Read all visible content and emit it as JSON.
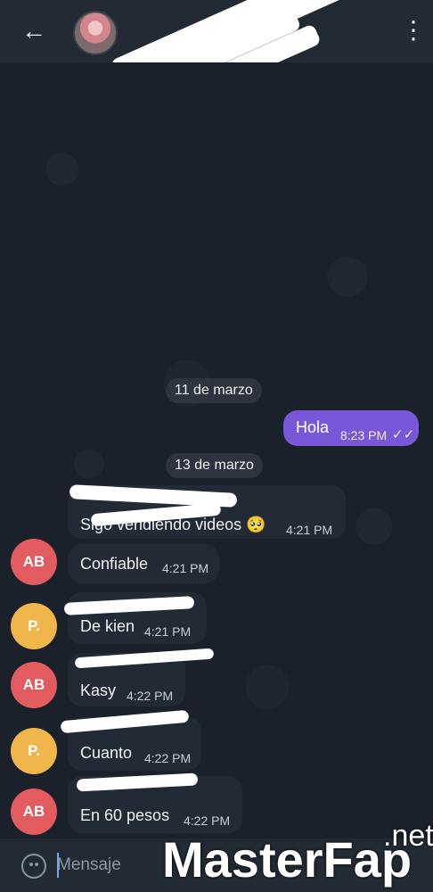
{
  "header": {
    "back_icon": "arrow-left-icon",
    "menu_icon": "more-vertical-icon"
  },
  "chat": {
    "date1": "11 de marzo",
    "outgoing": {
      "text": "Hola",
      "time": "8:23 PM",
      "status_icon": "double-check-icon"
    },
    "date2": "13 de marzo",
    "messages": [
      {
        "avatar": "",
        "text": "Sigo vendiendo videos 🥺",
        "time": "4:21 PM"
      },
      {
        "avatar": "AB",
        "text": "Confiable",
        "time": "4:21 PM"
      },
      {
        "avatar": "P.",
        "text": "De kien",
        "time": "4:21 PM"
      },
      {
        "avatar": "AB",
        "text": "Kasy",
        "time": "4:22 PM"
      },
      {
        "avatar": "P.",
        "text": "Cuanto",
        "time": "4:22 PM"
      },
      {
        "avatar": "AB",
        "text": "En 60 pesos",
        "time": "4:22 PM"
      }
    ]
  },
  "composer": {
    "placeholder": "Mensaje",
    "emoji_icon": "smiley-icon"
  },
  "watermark": {
    "main": "MasterFap",
    "suffix": ".net"
  },
  "colors": {
    "background": "#1a212a",
    "header": "#222a33",
    "incoming_bubble": "#222b35",
    "outgoing_bubble": "#7a56d8",
    "avatar_ab": "#e15b5f",
    "avatar_p": "#f0b64b"
  }
}
